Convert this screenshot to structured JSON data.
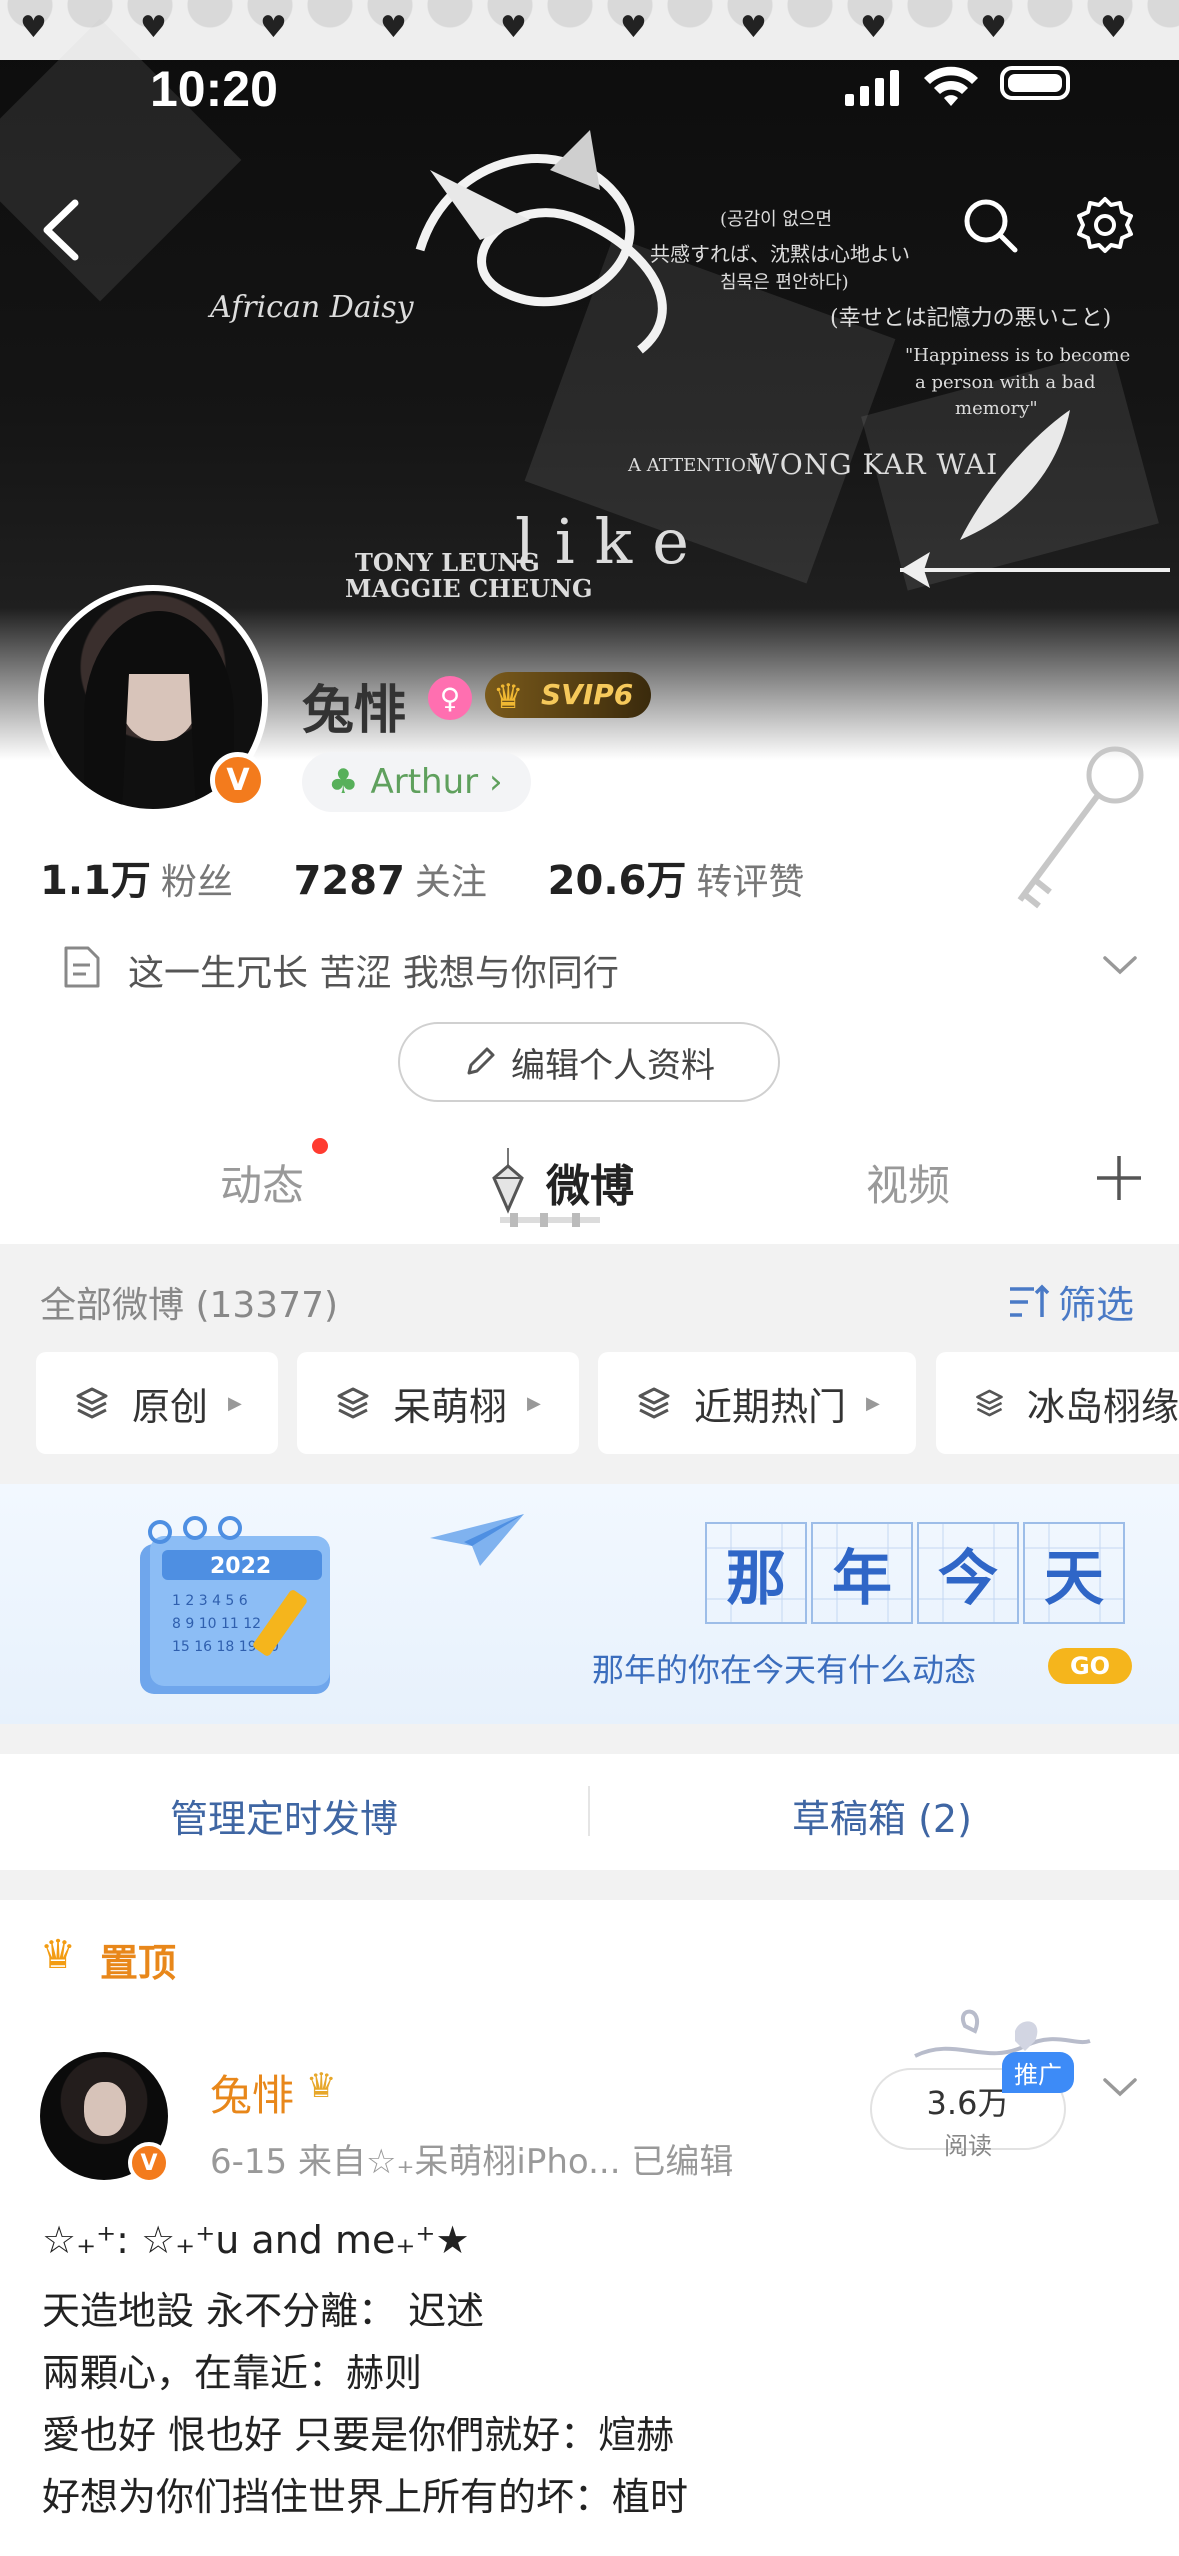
{
  "status_bar": {
    "time": "10:20"
  },
  "header_art": {
    "texts": [
      "African Daisy",
      "(공감이 없으면",
      "共感すれば、沈黙は心地よい",
      "침묵은 편안하다)",
      "(幸せとは記憶力の悪いこと)",
      "\"Happiness is to become",
      "a person with a bad",
      "memory\"",
      "WONG KAR WAI",
      "A ATTENTION",
      "TONY LEUNG",
      "MAGGIE CHEUNG",
      "like"
    ]
  },
  "profile": {
    "name": "兔悱",
    "svip": "SVIP6",
    "group": "Arthur",
    "stats": [
      {
        "value": "1.1万",
        "label": "粉丝"
      },
      {
        "value": "7287",
        "label": "关注"
      },
      {
        "value": "20.6万",
        "label": "转评赞"
      }
    ],
    "bio": "这一生冗长 苦涩 我想与你同行",
    "edit_label": "编辑个人资料"
  },
  "tabs": {
    "dongtai": "动态",
    "weibo": "微博",
    "video": "视频"
  },
  "filter": {
    "all_label": "全部微博 (13377)",
    "filter_label": "筛选",
    "chips": [
      "原创",
      "呆萌栩",
      "近期热门",
      "冰岛栩缘"
    ]
  },
  "memory": {
    "title_chars": [
      "那",
      "年",
      "今",
      "天"
    ],
    "subtitle": "那年的你在今天有什么动态",
    "go": "GO",
    "cal_year": "2022"
  },
  "actions": {
    "schedule": "管理定时发博",
    "drafts": "草稿箱 (2)"
  },
  "pinned": {
    "label": "置顶",
    "author": "兔悱",
    "meta": "6-15  来自☆₊呆萌栩iPho...   已编辑",
    "reads": "3.6万",
    "reads_label": "阅读",
    "promo": "推广",
    "lines": [
      "☆₊⁺: ☆₊⁺u and me₊⁺★",
      "天造地設 永不分離： 迟述",
      " 兩顆心，在靠近：赫则",
      "愛也好 恨也好 只要是你們就好：煊赫",
      "好想为你们挡住世界上所有的坏：植时"
    ]
  },
  "colors": {
    "accent_orange": "#e8871a",
    "link_blue": "#3f66a3",
    "verified_orange": "#f37b1d"
  }
}
